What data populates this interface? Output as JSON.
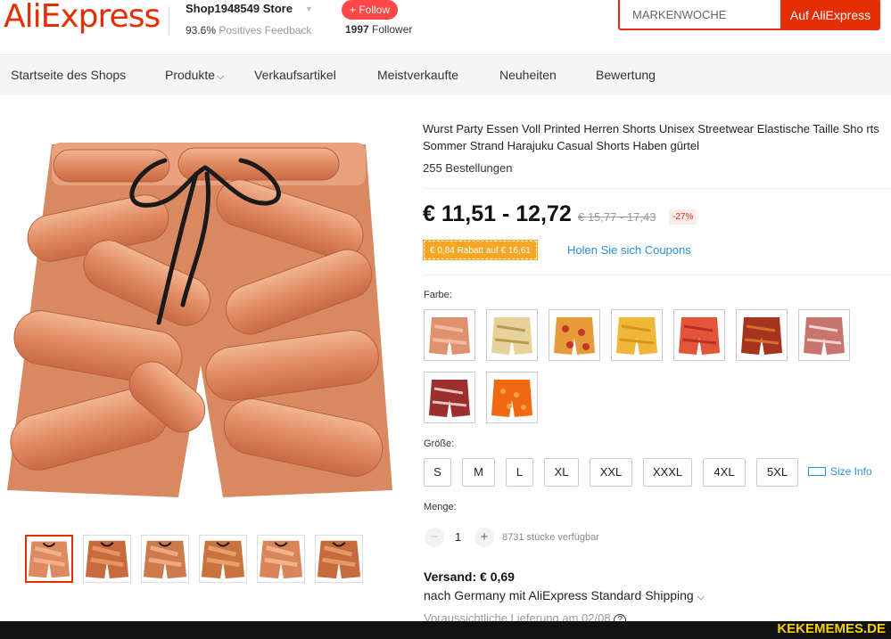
{
  "header": {
    "logo": "AliExpress",
    "store_name": "Shop1948549 Store",
    "feedback_value": "93.6%",
    "feedback_label": "Positives Feedback",
    "follow_label": "+ Follow",
    "followers_count": "1997",
    "followers_label": "Follower",
    "search_value": "MARKENWOCHE",
    "search_button": "Auf AliExpress"
  },
  "nav": {
    "items": [
      {
        "label": "Startseite des Shops"
      },
      {
        "label": "Produkte"
      },
      {
        "label": "Verkaufsartikel"
      },
      {
        "label": "Meistverkaufte"
      },
      {
        "label": "Neuheiten"
      },
      {
        "label": "Bewertung"
      }
    ]
  },
  "product": {
    "title": "Wurst Party Essen Voll Printed Herren Shorts Unisex Streetwear Elastische Taille Sho rts Sommer Strand Harajuku Casual Shorts Haben gürtel",
    "orders": "255 Bestellungen",
    "price": "€ 11,51 - 12,72",
    "original_price": "€ 15,77 - 17,43",
    "discount": "-27%",
    "coupon_tag": "€ 0,84 Rabatt auf € 16,61",
    "coupon_link": "Holen Sie sich Coupons",
    "color_label": "Farbe:",
    "size_label": "Größe:",
    "sizes": [
      "S",
      "M",
      "L",
      "XL",
      "XXL",
      "XXXL",
      "4XL",
      "5XL"
    ],
    "size_info": "Size Info",
    "qty_label": "Menge:",
    "qty_minus": "−",
    "qty_plus": "+",
    "qty_value": "1",
    "stock": "8731 stücke verfügbar",
    "shipping_title": "Versand: € 0,69",
    "shipping_method": "nach Germany mit AliExpress Standard Shipping",
    "delivery": "Voraussichtliche Lieferung am 02/08"
  },
  "colors": {
    "brand": "#e62e04",
    "follow": "#ff4747",
    "link": "#2e8fd7",
    "coupon": "#f5a623"
  },
  "watermark": "KEKEMEMES.DE"
}
